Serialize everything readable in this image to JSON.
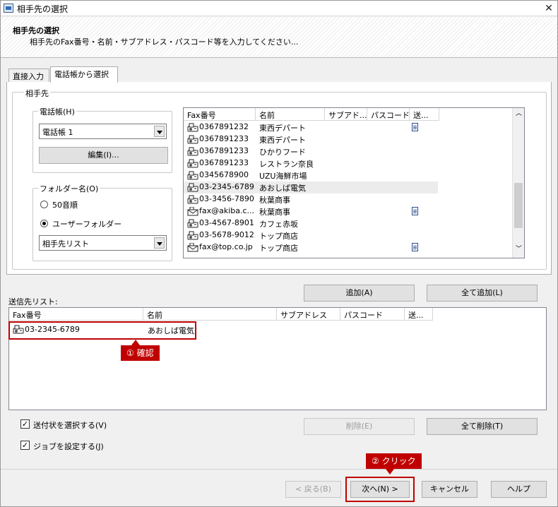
{
  "window": {
    "title": "相手先の選択",
    "close_glyph": "✕"
  },
  "header": {
    "title": "相手先の選択",
    "subtitle": "相手先のFax番号・名前・サブアドレス・パスコード等を入力してください..."
  },
  "tabs": [
    {
      "label": "直接入力"
    },
    {
      "label": "電話帳から選択"
    }
  ],
  "recipient_group": {
    "label": "相手先"
  },
  "phonebook": {
    "label": "電話帳(H)",
    "selected": "電話帳 1",
    "edit_button": "編集(I)..."
  },
  "folder": {
    "label": "フォルダー名(O)",
    "radio_50": "50音順",
    "radio_user": "ユーザーフォルダー",
    "selected": "相手先リスト"
  },
  "contacts": {
    "columns": [
      "Fax番号",
      "名前",
      "サブアド...",
      "パスコード",
      "送..."
    ],
    "rows": [
      {
        "fax": "0367891232",
        "name": "東西デパート",
        "doc": true,
        "type": "fax"
      },
      {
        "fax": "0367891233",
        "name": "東西デパート",
        "doc": false,
        "type": "fax"
      },
      {
        "fax": "0367891233",
        "name": "ひかりフード",
        "doc": false,
        "type": "fax"
      },
      {
        "fax": "0367891233",
        "name": "レストラン奈良",
        "doc": false,
        "type": "fax"
      },
      {
        "fax": "0345678900",
        "name": "UZU海鮮市場",
        "doc": false,
        "type": "fax"
      },
      {
        "fax": "03-2345-6789",
        "name": "あおしば電気",
        "doc": false,
        "type": "fax"
      },
      {
        "fax": "03-3456-7890",
        "name": "秋葉商事",
        "doc": false,
        "type": "fax"
      },
      {
        "fax": "fax@akiba.c...",
        "name": "秋葉商事",
        "doc": true,
        "type": "email"
      },
      {
        "fax": "03-4567-8901",
        "name": "カフェ赤坂",
        "doc": false,
        "type": "fax"
      },
      {
        "fax": "03-5678-9012",
        "name": "トップ商店",
        "doc": false,
        "type": "fax"
      },
      {
        "fax": "fax@top.co.jp",
        "name": "トップ商店",
        "doc": true,
        "type": "email"
      }
    ]
  },
  "actions": {
    "add": "追加(A)",
    "add_all": "全て追加(L)",
    "delete": "削除(E)",
    "delete_all": "全て削除(T)"
  },
  "send_list": {
    "label": "送信先リスト:",
    "columns": [
      "Fax番号",
      "名前",
      "サブアドレス",
      "パスコード",
      "送..."
    ],
    "rows": [
      {
        "fax": "03-2345-6789",
        "name": "あおしば電気"
      }
    ]
  },
  "options": {
    "cover": "送付状を選択する(V)",
    "job": "ジョブを設定する(J)"
  },
  "footer": {
    "back": "< 戻る(B)",
    "next": "次へ(N) >",
    "cancel": "キャンセル",
    "help": "ヘルプ"
  },
  "annotations": {
    "confirm": "① 確認",
    "click": "② クリック"
  }
}
